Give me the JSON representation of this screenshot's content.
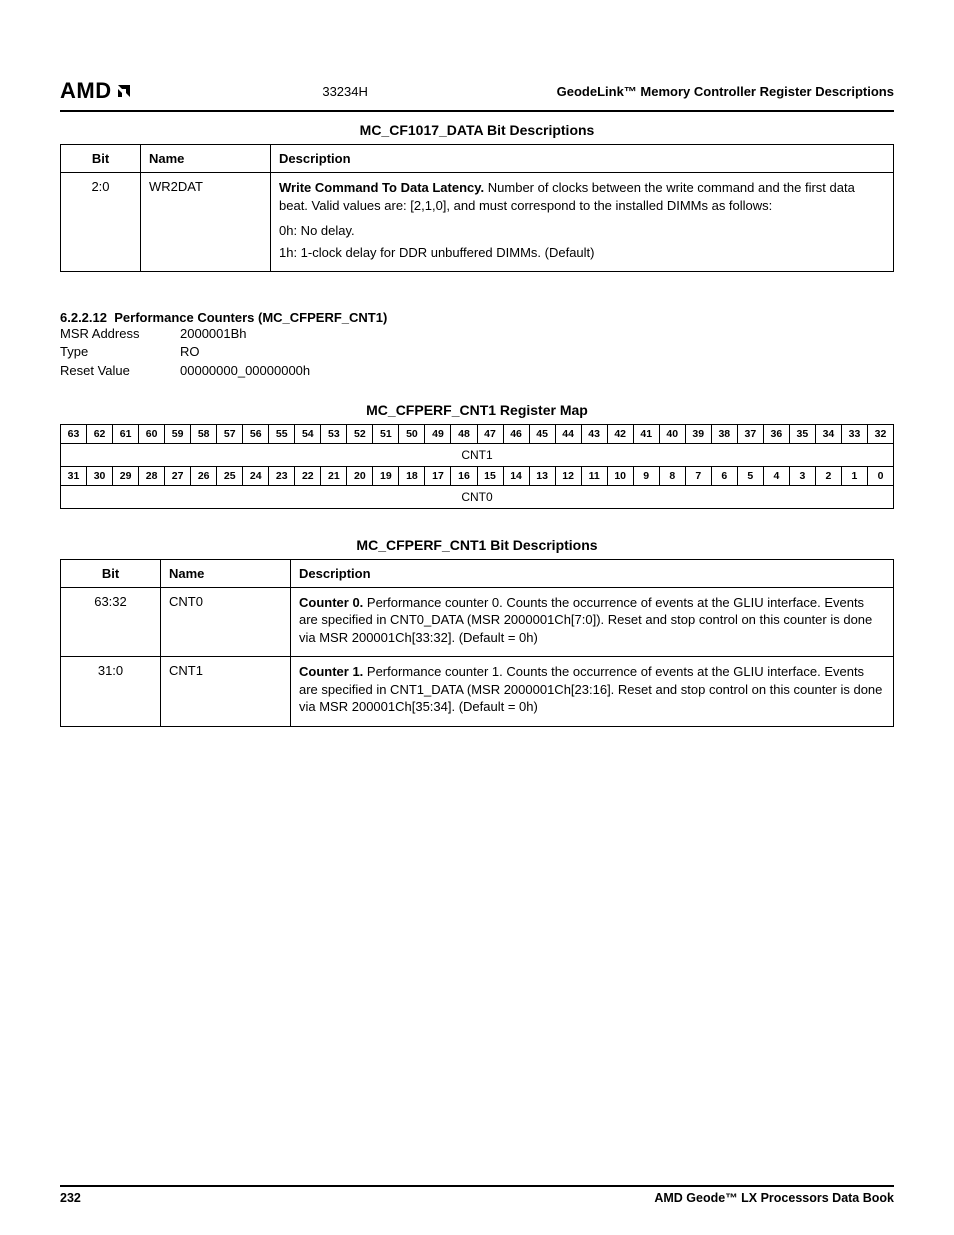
{
  "header": {
    "logo_text": "AMD",
    "doc_num": "33234H",
    "title": "GeodeLink™ Memory Controller Register Descriptions"
  },
  "table1": {
    "title": "MC_CF1017_DATA Bit Descriptions",
    "cols": {
      "bit": "Bit",
      "name": "Name",
      "desc": "Description"
    },
    "rows": [
      {
        "bit": "2:0",
        "name": "WR2DAT",
        "desc_bold": "Write Command To Data Latency.",
        "desc_rest": " Number of clocks between the write command and the first data beat. Valid values are: [2,1,0], and must correspond to the installed DIMMs as follows:",
        "line2": "0h: No delay.",
        "line3": "1h: 1-clock delay for DDR unbuffered DIMMs. (Default)"
      }
    ]
  },
  "section": {
    "num": "6.2.2.12",
    "title": "Performance Counters (MC_CFPERF_CNT1)",
    "kv": [
      {
        "k": "MSR Address",
        "v": "2000001Bh"
      },
      {
        "k": "Type",
        "v": "RO"
      },
      {
        "k": "Reset Value",
        "v": "00000000_00000000h"
      }
    ]
  },
  "regmap": {
    "title": "MC_CFPERF_CNT1 Register Map",
    "row1_bits": [
      "63",
      "62",
      "61",
      "60",
      "59",
      "58",
      "57",
      "56",
      "55",
      "54",
      "53",
      "52",
      "51",
      "50",
      "49",
      "48",
      "47",
      "46",
      "45",
      "44",
      "43",
      "42",
      "41",
      "40",
      "39",
      "38",
      "37",
      "36",
      "35",
      "34",
      "33",
      "32"
    ],
    "row1_span": "CNT1",
    "row2_bits": [
      "31",
      "30",
      "29",
      "28",
      "27",
      "26",
      "25",
      "24",
      "23",
      "22",
      "21",
      "20",
      "19",
      "18",
      "17",
      "16",
      "15",
      "14",
      "13",
      "12",
      "11",
      "10",
      "9",
      "8",
      "7",
      "6",
      "5",
      "4",
      "3",
      "2",
      "1",
      "0"
    ],
    "row2_span": "CNT0"
  },
  "table2": {
    "title": "MC_CFPERF_CNT1 Bit Descriptions",
    "cols": {
      "bit": "Bit",
      "name": "Name",
      "desc": "Description"
    },
    "rows": [
      {
        "bit": "63:32",
        "name": "CNT0",
        "desc_bold": "Counter 0.",
        "desc_rest": " Performance counter 0. Counts the occurrence of events at the GLIU interface. Events are specified in CNT0_DATA (MSR 2000001Ch[7:0]). Reset and stop control on this counter is done via MSR 200001Ch[33:32]. (Default = 0h)"
      },
      {
        "bit": "31:0",
        "name": "CNT1",
        "desc_bold": "Counter 1.",
        "desc_rest": " Performance counter 1. Counts the occurrence of events at the GLIU interface. Events are specified in CNT1_DATA (MSR 2000001Ch[23:16]. Reset and stop control on this counter is done via MSR 200001Ch[35:34]. (Default = 0h)"
      }
    ]
  },
  "footer": {
    "page": "232",
    "book": "AMD Geode™ LX Processors Data Book"
  }
}
